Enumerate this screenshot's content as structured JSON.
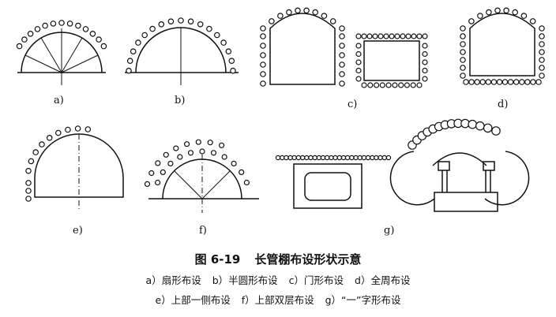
{
  "sublabels": {
    "a": "a)",
    "b": "b)",
    "c": "c)",
    "d": "d)",
    "e": "e)",
    "f": "f)",
    "g": "g)"
  },
  "caption": {
    "figure_number": "图 6-19",
    "title": "长管棚布设形状示意",
    "line1": [
      "a）扇形布设",
      "b）半圆形布设",
      "c）门形布设",
      "d）全周布设"
    ],
    "line2": [
      "e）上部一侧布设",
      "f）上部双层布设",
      "g）“一”字形布设"
    ]
  }
}
